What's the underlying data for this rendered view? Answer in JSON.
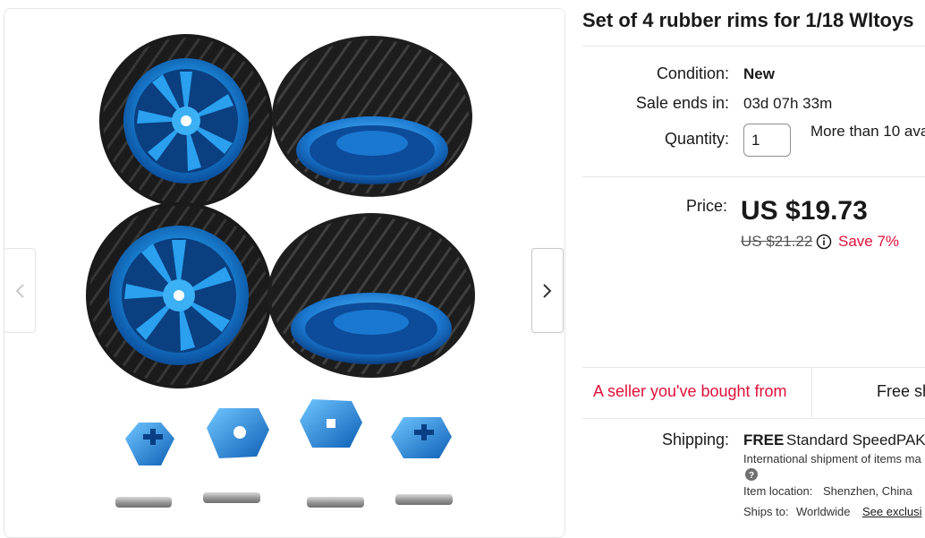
{
  "listing": {
    "title": "Set of 4 rubber rims for 1/18 Wltoys"
  },
  "details": {
    "condition_label": "Condition:",
    "condition_value": "New",
    "sale_label": "Sale ends in:",
    "sale_value": "03d 07h 33m",
    "quantity_label": "Quantity:",
    "quantity_value": "1",
    "availability": "More than 10 ava"
  },
  "pricing": {
    "label": "Price:",
    "current": "US $19.73",
    "original": "US $21.22",
    "discount": "Save 7%"
  },
  "tabs": {
    "seller_tab": "A seller you've bought from",
    "shipping_tab": "Free sh"
  },
  "shipping": {
    "label": "Shipping:",
    "free": "FREE",
    "method": "Standard SpeedPAK",
    "note": "International shipment of items ma",
    "location_label": "Item location:",
    "location_value": "Shenzhen, China",
    "ships_label": "Ships to:",
    "ships_value": "Worldwide",
    "exclusions_link": "See exclusi"
  },
  "colors": {
    "accent_red": "#e0103a",
    "rim_blue": "#1f8fe0",
    "tire_black": "#1c1c1c"
  },
  "icons": {
    "prev": "chevron-left-icon",
    "next": "chevron-right-icon",
    "info": "info-icon",
    "help": "help-icon"
  }
}
